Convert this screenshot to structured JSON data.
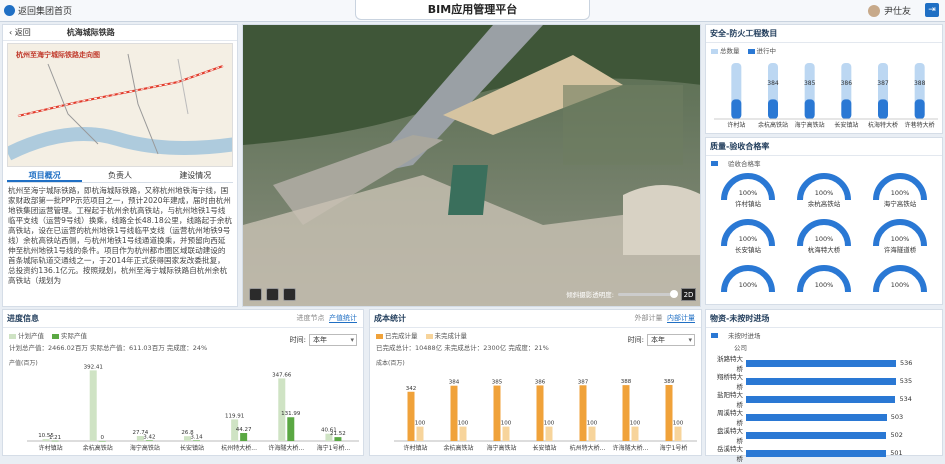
{
  "header": {
    "home": "返回集团首页",
    "title": "BIM应用管理平台",
    "user": "尹仕友"
  },
  "left": {
    "back": "返回",
    "line": "杭海城际铁路",
    "map_title": "杭州至海宁城际铁路走向图",
    "tabs": [
      "项目概况",
      "负责人",
      "建设情况"
    ],
    "desc": "杭州至海宁城际铁路，即杭海城际铁路，又称杭州地铁海宁线，国家财政部第一批PPP示范项目之一，预计2020年建成，届时由杭州地铁集团运营管理。工程起于杭州余杭高铁站，与杭州地铁1号线临平支线（运营9号线）换乘，线路全长48.18公里，线路起于余杭高铁站，设在已运营的杭州地铁1号线临平支线（运营杭州地铁9号线）余杭高铁站西侧，与杭州地铁1号线通道换乘，并预留向西延伸至杭州地铁1号线的条件。项目作为杭州都市圈区域联动建设的首条城际轨道交通线之一，于2014年正式获得国家发改委批复，总投资约136.1亿元。按照规划，杭州至海宁城际铁路自杭州余杭高铁站（规划为"
  },
  "scene": {
    "slider_label": "倾斜摄影透明度:",
    "mode": "2D"
  },
  "safety": {
    "title": "安全-防火工程数目",
    "legend": [
      "总数量",
      "进行中"
    ],
    "chart_data": {
      "type": "bar",
      "categories": [
        "许村站",
        "余杭高铁站",
        "海宁高铁站",
        "长安镇站",
        "杭海特大桥",
        "许巷特大桥"
      ],
      "series": [
        {
          "name": "总数量",
          "values": [
            100,
            384,
            385,
            386,
            387,
            388
          ]
        },
        {
          "name": "进行中",
          "values": [
            100,
            100,
            100,
            100,
            100,
            100
          ]
        }
      ],
      "labels": [
        "",
        "384",
        "385",
        "386",
        "387",
        "388"
      ]
    }
  },
  "rate": {
    "title": "质量-验收合格率",
    "legend": "验收合格率",
    "items": [
      {
        "name": "许村镇站",
        "value": "100%"
      },
      {
        "name": "余杭高铁站",
        "value": "100%"
      },
      {
        "name": "海宁高铁站",
        "value": "100%"
      },
      {
        "name": "长安镇站",
        "value": "100%"
      },
      {
        "name": "杭海特大桥",
        "value": "100%"
      },
      {
        "name": "许海隧道桥",
        "value": "100%"
      },
      {
        "name": "",
        "value": "100%"
      },
      {
        "name": "",
        "value": "100%"
      },
      {
        "name": "",
        "value": "100%"
      }
    ]
  },
  "progress": {
    "title": "进度信息",
    "tabs": [
      "进度节点",
      "产值统计"
    ],
    "legend": [
      "计划产值",
      "实际产值"
    ],
    "summary": "计划总产值：2466.02百万 实际总产值：611.03百万 完成度：24%",
    "time_label": "时间:",
    "time_value": "本年",
    "ylabel": "产值(百万)",
    "chart_data": {
      "type": "bar",
      "categories": [
        "许村镇站",
        "余杭高铁站",
        "海宁高铁站",
        "长安镇站",
        "杭州特大桥...",
        "许海隧大桥...",
        "海宁1号桥..."
      ],
      "series": [
        {
          "name": "计划产值",
          "values": [
            10.55,
            392.41,
            27.74,
            26.8,
            119.91,
            347.66,
            40.61
          ]
        },
        {
          "name": "实际产值",
          "values": [
            1.21,
            0,
            3.42,
            3.14,
            44.27,
            131.99,
            21.52
          ]
        }
      ],
      "ylim": [
        0,
        400
      ]
    }
  },
  "cost": {
    "title": "成本统计",
    "tabs": [
      "外部计量",
      "内部计量"
    ],
    "legend": [
      "已完成计量",
      "未完成计量"
    ],
    "summary": "已完成总计：10488亿 未完成总计：2300亿 完成度：21%",
    "time_label": "时间:",
    "time_value": "本年",
    "ylabel": "成本(百万)",
    "chart_data": {
      "type": "bar",
      "categories": [
        "许村镇站",
        "余杭高铁站",
        "海宁高铁站",
        "长安镇站",
        "杭州特大桥...",
        "许海隧大桥...",
        "海宁1号桥"
      ],
      "series": [
        {
          "name": "已完成计量",
          "values": [
            342,
            384,
            385,
            386,
            387,
            388,
            389
          ]
        },
        {
          "name": "未完成计量",
          "values": [
            100,
            100,
            100,
            100,
            100,
            100,
            100
          ]
        }
      ],
      "ylim": [
        0,
        500
      ]
    }
  },
  "delay": {
    "title": "物资-未按时进场",
    "legend": "未按时进场",
    "subtitle": "公司",
    "items": [
      {
        "name": "浙路特大桥",
        "value": "536"
      },
      {
        "name": "翔桥特大桥",
        "value": "535"
      },
      {
        "name": "盐阳特大桥",
        "value": "534"
      },
      {
        "name": "周溪特大桥",
        "value": "503"
      },
      {
        "name": "盘溪特大桥",
        "value": "502"
      },
      {
        "name": "岳溪特大桥",
        "value": "501"
      }
    ]
  }
}
